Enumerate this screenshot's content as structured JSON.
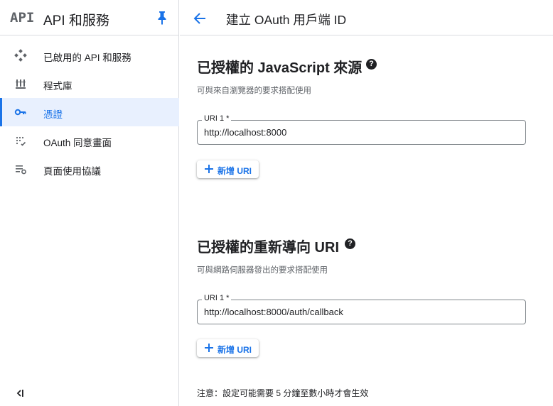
{
  "sidebar": {
    "logo_text": "API",
    "title": "API 和服務",
    "items": [
      {
        "label": "已啟用的 API 和服務",
        "icon": "enabled-apis-icon"
      },
      {
        "label": "程式庫",
        "icon": "library-icon"
      },
      {
        "label": "憑證",
        "icon": "key-icon",
        "active": true
      },
      {
        "label": "OAuth 同意畫面",
        "icon": "oauth-consent-icon"
      },
      {
        "label": "頁面使用協議",
        "icon": "page-usage-settings-icon"
      }
    ],
    "collapse_icon": "collapse-sidebar-icon"
  },
  "header": {
    "title": "建立 OAuth 用戶端 ID",
    "back_icon": "back-arrow-icon"
  },
  "sections": {
    "js_origins": {
      "title": "已授權的 JavaScript 來源",
      "description": "可與來自瀏覽器的要求搭配使用",
      "field_label": "URI 1 *",
      "field_value": "http://localhost:8000",
      "add_button": "新增 URI"
    },
    "redirect_uris": {
      "title": "已授權的重新導向 URI",
      "description": "可與網路伺服器發出的要求搭配使用",
      "field_label": "URI 1 *",
      "field_value": "http://localhost:8000/auth/callback",
      "add_button": "新增 URI"
    }
  },
  "note": "注意：設定可能需要 5 分鐘至數小時才會生效",
  "colors": {
    "accent": "#1a73e8",
    "active_bg": "#e8f0fe",
    "text": "#202124",
    "muted": "#5f6368",
    "border": "#dadce0"
  }
}
